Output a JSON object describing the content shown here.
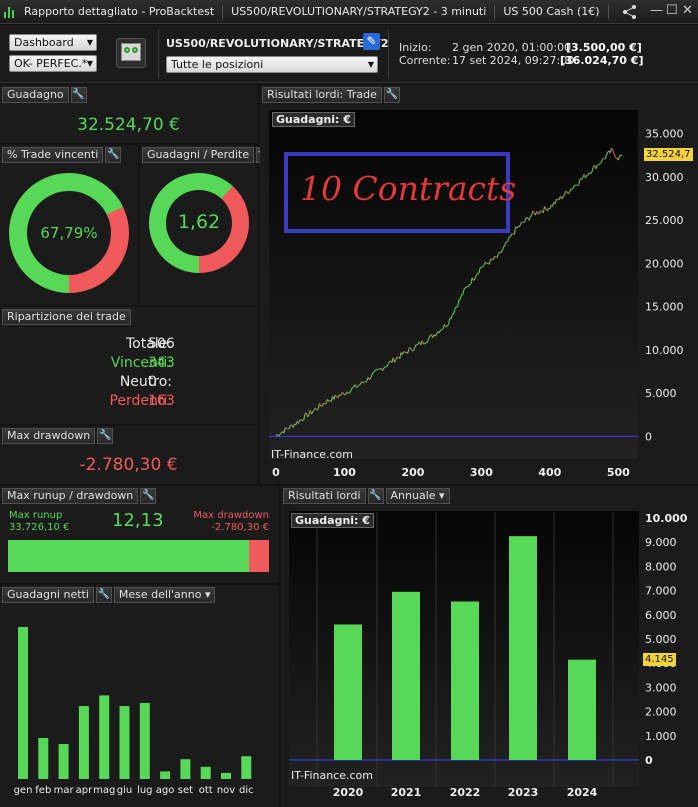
{
  "titlebar": {
    "title": "Rapporto dettagliato - ProBacktest",
    "strategy": "US500/REVOLUTIONARY/STRATEGY2 - 3 minuti",
    "instrument": "US 500 Cash (1€)"
  },
  "toolbar": {
    "view_select": "Dashboard",
    "system_select": "OK- PERFEC.*",
    "strategy_name": "US500/REVOLUTIONARY/STRATEGY2",
    "positions_select": "Tutte le posizioni",
    "start_label": "Inizio:",
    "start_date": "2 gen 2020, 01:00:00",
    "start_value": "[3.500,00 €]",
    "current_label": "Corrente:",
    "current_date": "17 set 2024, 09:27:00",
    "current_value": "[36.024,70 €]"
  },
  "guadagno": {
    "title": "Guadagno",
    "value": "32.524,70 €"
  },
  "winning_trades": {
    "title": "% Trade vincenti",
    "value": "67,79%",
    "fraction": 0.6779
  },
  "profit_loss": {
    "title": "Guadagni / Perdite",
    "value": "1,62",
    "fraction": 0.618
  },
  "trade_split": {
    "title": "Ripartizione dei trade",
    "rows": [
      {
        "label": "Totale:",
        "value": "506"
      },
      {
        "label": "Vincenti:",
        "value": "343"
      },
      {
        "label": "Neutro:",
        "value": "0"
      },
      {
        "label": "Perdenti:",
        "value": "163"
      }
    ]
  },
  "max_drawdown": {
    "title": "Max drawdown",
    "value": "-2.780,30 €"
  },
  "runup": {
    "title": "Max runup / drawdown",
    "runup_label": "Max runup",
    "runup_value": "33.726,10 €",
    "ratio": "12,13",
    "drawdown_label": "Max drawdown",
    "drawdown_value": "-2.780,30 €",
    "runup_fraction": 0.924
  },
  "gross_results_trade": {
    "title": "Risultati lordi: Trade"
  },
  "gross_results_year": {
    "title": "Risultati lordi",
    "period_select": "Annuale"
  },
  "net_gains": {
    "title": "Guadagni netti",
    "period_select": "Mese dell'anno"
  },
  "annotation": "10 Contracts",
  "colors": {
    "green": "#57d957",
    "red": "#f05a5a",
    "accent_blue": "#3b3bbf",
    "tag_yellow": "#f3d23b"
  },
  "chart_data": [
    {
      "type": "line",
      "name": "equity-curve",
      "label": "Guadagni: €",
      "source": "IT-Finance.com",
      "x": [
        0,
        25,
        50,
        75,
        100,
        125,
        150,
        175,
        200,
        225,
        250,
        275,
        300,
        325,
        350,
        375,
        400,
        425,
        450,
        475,
        490,
        500,
        506
      ],
      "y": [
        100,
        1300,
        2700,
        4100,
        5000,
        6100,
        7600,
        9000,
        10200,
        11400,
        13000,
        16800,
        19600,
        20800,
        23900,
        25700,
        26500,
        28200,
        30000,
        31800,
        33000,
        32200,
        32524.7
      ],
      "xticks": [
        "0",
        "100",
        "200",
        "300",
        "400",
        "500"
      ],
      "xlim": [
        0,
        520
      ],
      "yticks": [
        "0",
        "5.000",
        "10.000",
        "15.000",
        "20.000",
        "25.000",
        "30.000",
        "35.000"
      ],
      "ylim": [
        -1000,
        36000
      ],
      "last_value_tag": "32.524,7"
    },
    {
      "type": "bar",
      "name": "annual-gross",
      "label": "Guadagni: €",
      "source": "IT-Finance.com",
      "categories": [
        "2020",
        "2021",
        "2022",
        "2023",
        "2024"
      ],
      "values": [
        5600,
        6950,
        6550,
        9250,
        4145
      ],
      "yticks": [
        "0",
        "1.000",
        "2.000",
        "3.000",
        "4.000",
        "5.000",
        "6.000",
        "7.000",
        "8.000",
        "9.000",
        "10.000"
      ],
      "ylim": [
        0,
        10000
      ],
      "last_value_tag": "4.145"
    },
    {
      "type": "bar",
      "name": "monthly-net",
      "categories": [
        "gen",
        "feb",
        "mar",
        "apr",
        "mag",
        "giu",
        "lug",
        "ago",
        "set",
        "ott",
        "nov",
        "dic"
      ],
      "values": [
        100,
        27,
        23,
        48,
        55,
        48,
        50,
        5,
        13,
        8,
        4,
        15
      ]
    }
  ]
}
